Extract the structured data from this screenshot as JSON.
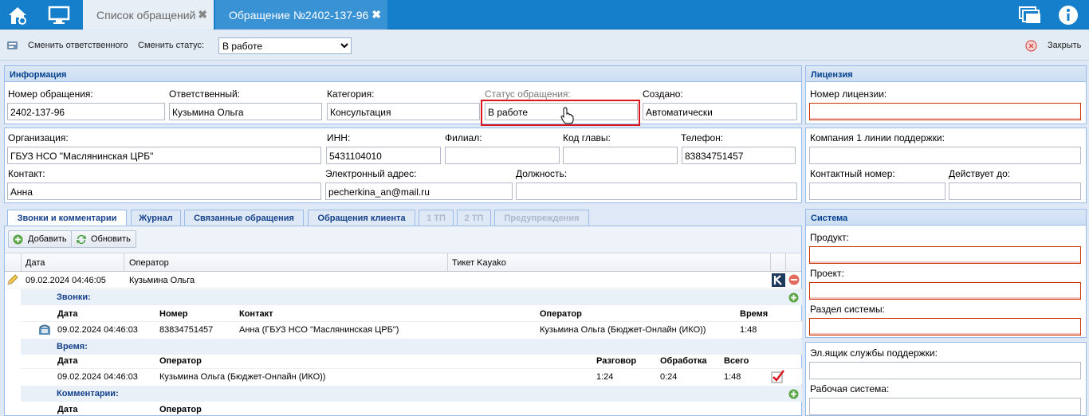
{
  "tabs": {
    "list_label": "Список обращений",
    "active_label": "Обращение №2402-137-96"
  },
  "toolbar": {
    "change_responsible": "Сменить ответственного",
    "change_status_label": "Сменить статус:",
    "status_value": "В работе",
    "close_label": "Закрыть"
  },
  "info": {
    "title": "Информация",
    "number_label": "Номер обращения:",
    "number_value": "2402-137-96",
    "responsible_label": "Ответственный:",
    "responsible_value": "Кузьмина Ольга",
    "category_label": "Категория:",
    "category_value": "Консультация",
    "status_label": "Статус обращения:",
    "status_value": "В работе",
    "created_label": "Создано:",
    "created_value": "Автоматически"
  },
  "org": {
    "org_label": "Организация:",
    "org_value": "ГБУЗ НСО \"Маслянинская ЦРБ\"",
    "inn_label": "ИНН:",
    "inn_value": "5431104010",
    "branch_label": "Филиал:",
    "branch_value": "",
    "code_label": "Код главы:",
    "code_value": "",
    "phone_label": "Телефон:",
    "phone_value": "83834751457",
    "contact_label": "Контакт:",
    "contact_value": "Анна",
    "email_label": "Электронный адрес:",
    "email_value": "pecherkina_an@mail.ru",
    "position_label": "Должность:",
    "position_value": ""
  },
  "license": {
    "title": "Лицензия",
    "number_label": "Номер лицензии:",
    "company_label": "Компания 1 линии поддержки:",
    "contact_num_label": "Контактный номер:",
    "valid_label": "Действует до:"
  },
  "system": {
    "title": "Система",
    "product_label": "Продукт:",
    "project_label": "Проект:",
    "section_label": "Раздел системы:",
    "email_label": "Эл.ящик службы поддержки:",
    "worksys_label": "Рабочая система:"
  },
  "subtabs": [
    "Звонки и комментарии",
    "Журнал",
    "Связанные обращения",
    "Обращения клиента",
    "1 ТП",
    "2 ТП",
    "Предупреждения"
  ],
  "grid": {
    "add": "Добавить",
    "refresh": "Обновить",
    "col_date": "Дата",
    "col_operator": "Оператор",
    "col_ticket": "Тикет Kayako",
    "row_date": "09.02.2024 04:46:05",
    "row_operator": "Кузьмина Ольга"
  },
  "calls": {
    "title": "Звонки:",
    "h_date": "Дата",
    "h_number": "Номер",
    "h_contact": "Контакт",
    "h_operator": "Оператор",
    "h_time": "Время",
    "date": "09.02.2024 04:46:03",
    "number": "83834751457",
    "contact": "Анна (ГБУЗ НСО \"Маслянинская ЦРБ\")",
    "operator": "Кузьмина Ольга (Бюджет-Онлайн (ИКО))",
    "time": "1:48"
  },
  "times": {
    "title": "Время:",
    "h_date": "Дата",
    "h_operator": "Оператор",
    "h_talk": "Разговор",
    "h_process": "Обработка",
    "h_total": "Всего",
    "date": "09.02.2024 04:46:03",
    "operator": "Кузьмина Ольга (Бюджет-Онлайн (ИКО))",
    "talk": "1:24",
    "process": "0:24",
    "total": "1:48"
  },
  "comments": {
    "title": "Комментарии:",
    "h_date": "Дата",
    "h_operator": "Оператор"
  }
}
